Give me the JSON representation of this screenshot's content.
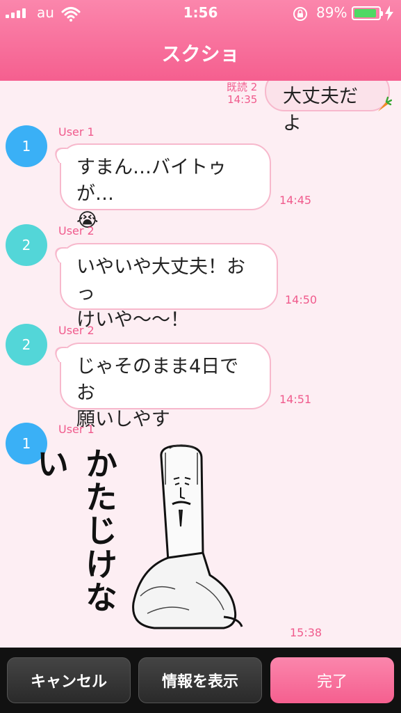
{
  "status": {
    "carrier": "au",
    "time": "1:56",
    "battery_percent": "89%",
    "battery_level": 0.89,
    "battery_color": "#4ed964"
  },
  "header": {
    "title": "スクショ",
    "bg_color": "#f55f8f"
  },
  "chat": {
    "my_message": {
      "read_label": "既読 2",
      "time": "14:35",
      "text": "大丈夫だよ"
    },
    "messages": [
      {
        "avatar": "1",
        "user": "User 1",
        "text_line1": "すまん…バイトゥが…",
        "emoji": "😭",
        "time": "14:45"
      },
      {
        "avatar": "2",
        "user": "User 2",
        "text_line1": "いやいや大丈夫！おっ",
        "text_line2": "けいや〜〜！",
        "time": "14:50"
      },
      {
        "avatar": "2",
        "user": "User 2",
        "text_line1": "じゃそのまま4日でお",
        "text_line2": "願いしやす",
        "time": "14:51"
      },
      {
        "avatar": "1",
        "user": "User 1",
        "sticker_text": "かたじけない",
        "time": "15:38"
      }
    ]
  },
  "footer": {
    "cancel_label": "キャンセル",
    "info_label": "情報を表示",
    "done_label": "完了"
  }
}
